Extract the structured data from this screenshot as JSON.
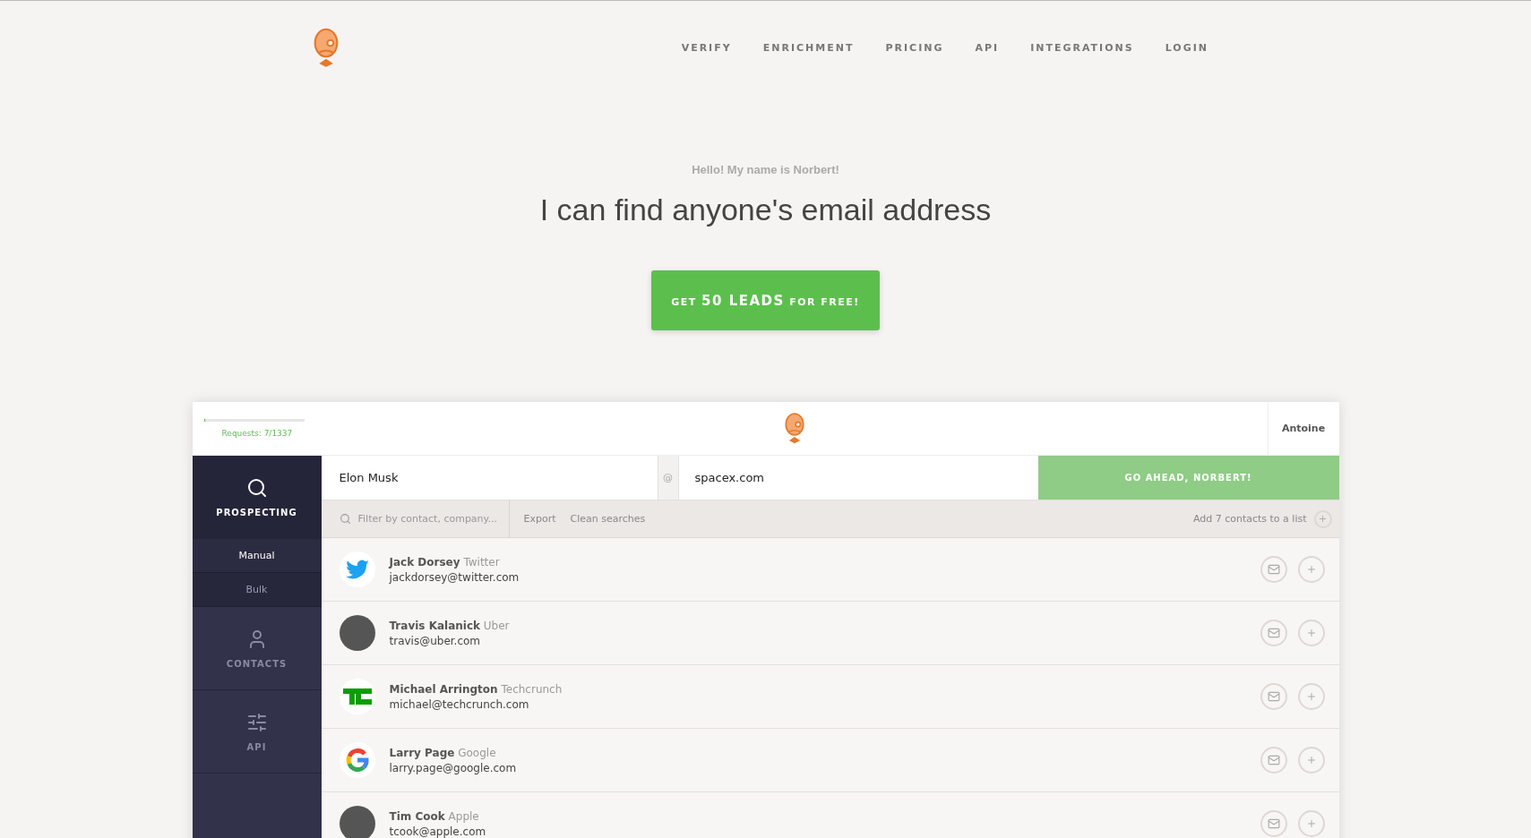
{
  "nav": {
    "links": [
      "VERIFY",
      "ENRICHMENT",
      "PRICING",
      "API",
      "INTEGRATIONS",
      "LOGIN"
    ]
  },
  "hero": {
    "greeting": "Hello! My name is Norbert!",
    "headline": "I can find anyone's email address",
    "cta": {
      "prefix": "GET",
      "highlight": "50 LEADS",
      "suffix": "FOR FREE!"
    }
  },
  "app": {
    "requests": {
      "label": "Requests: 7/1337",
      "level": 0.005
    },
    "user": "Antoine",
    "sidebar": [
      {
        "label": "PROSPECTING",
        "kind": "search",
        "selected": true,
        "children": [
          {
            "label": "Manual",
            "selected": true
          },
          {
            "label": "Bulk",
            "selected": false
          }
        ]
      },
      {
        "label": "CONTACTS",
        "kind": "user",
        "selected": false
      },
      {
        "label": "API",
        "kind": "sliders",
        "selected": false
      }
    ],
    "search": {
      "name_value": "Elon Musk",
      "at": "@",
      "domain_value": "spacex.com",
      "submit": "GO AHEAD, NORBERT!"
    },
    "toolbar": {
      "filter_placeholder": "Filter by contact, company...",
      "actions": [
        "Export",
        "Clean searches"
      ],
      "add_to_list": "Add 7 contacts to a list"
    },
    "contacts": [
      {
        "name": "Jack Dorsey",
        "company": "Twitter",
        "email": "jackdorsey@twitter.com",
        "kind": "twitter"
      },
      {
        "name": "Travis Kalanick",
        "company": "Uber",
        "email": "travis@uber.com",
        "kind": "photo"
      },
      {
        "name": "Michael Arrington",
        "company": "Techcrunch",
        "email": "michael@techcrunch.com",
        "kind": "tc"
      },
      {
        "name": "Larry Page",
        "company": "Google",
        "email": "larry.page@google.com",
        "kind": "google"
      },
      {
        "name": "Tim Cook",
        "company": "Apple",
        "email": "tcook@apple.com",
        "kind": "photo"
      }
    ]
  }
}
